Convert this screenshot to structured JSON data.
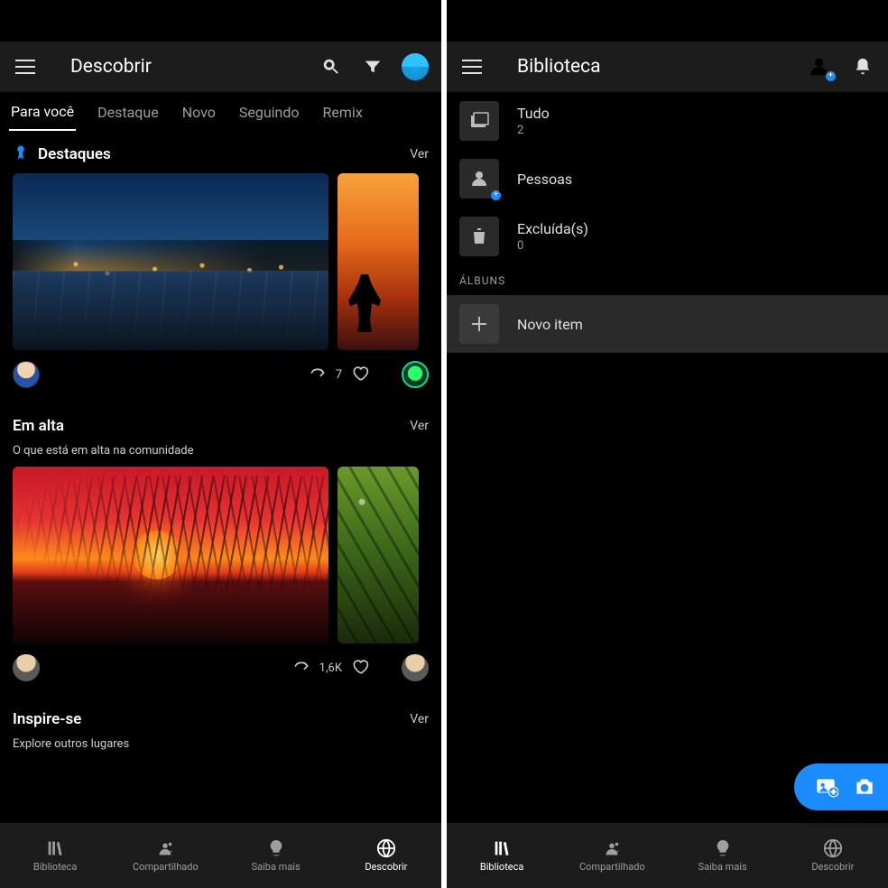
{
  "left": {
    "appbar_title": "Descobrir",
    "tabs": [
      "Para você",
      "Destaque",
      "Novo",
      "Seguindo",
      "Remix"
    ],
    "active_tab": 0,
    "sections": {
      "destaques": {
        "title": "Destaques",
        "see_all": "Ver",
        "share_count": "7"
      },
      "em_alta": {
        "title": "Em alta",
        "subtitle": "O que está em alta na comunidade",
        "see_all": "Ver",
        "share_count": "1,6K"
      },
      "inspire": {
        "title": "Inspire-se",
        "subtitle": "Explore outros lugares",
        "see_all": "Ver"
      }
    },
    "bottom_nav": {
      "items": [
        "Biblioteca",
        "Compartilhado",
        "Saiba mais",
        "Descobrir"
      ],
      "active": 3
    }
  },
  "right": {
    "appbar_title": "Biblioteca",
    "list": {
      "all": {
        "label": "Tudo",
        "count": "2"
      },
      "people": {
        "label": "Pessoas"
      },
      "deleted": {
        "label": "Excluída(s)",
        "count": "0"
      }
    },
    "albums_header": "ÁLBUNS",
    "new_item": "Novo item",
    "bottom_nav": {
      "items": [
        "Biblioteca",
        "Compartilhado",
        "Saiba mais",
        "Descobrir"
      ],
      "active": 0
    }
  }
}
